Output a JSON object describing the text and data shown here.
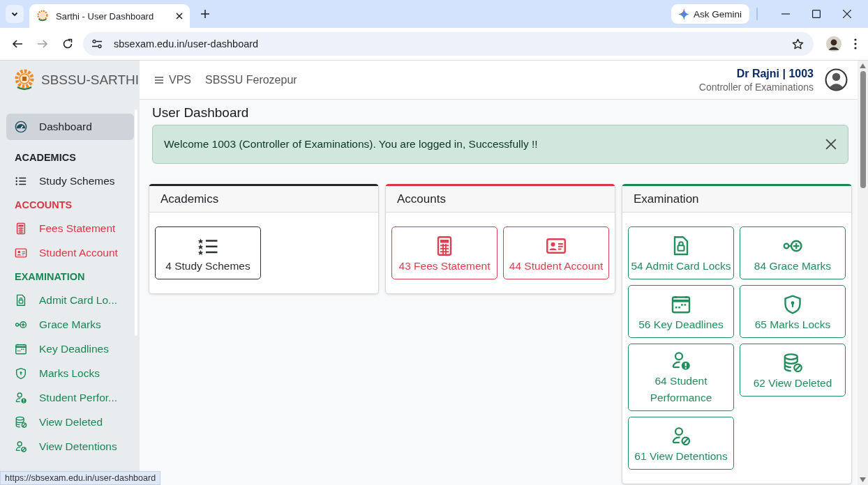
{
  "browser": {
    "tab_title": "Sarthi - User Dashboard",
    "ask_button": "Ask Gemini",
    "url": "sbsexam.edu.in/user-dashboard",
    "status_url": "https://sbsexam.edu.in/user-dashboard"
  },
  "sidebar": {
    "brand": "SBSSU-SARTHI",
    "items": [
      {
        "label": "Dashboard",
        "selected": true
      }
    ],
    "groups": [
      {
        "title": "ACADEMICS",
        "color": "#212529",
        "items": [
          {
            "label": "Study Schemes",
            "selected": false
          }
        ]
      },
      {
        "title": "ACCOUNTS",
        "color": "#dc3545",
        "items": [
          {
            "label": "Fees Statement",
            "selected": false
          },
          {
            "label": "Student Account",
            "selected": false
          }
        ]
      },
      {
        "title": "EXAMINATION",
        "color": "#198754",
        "items": [
          {
            "label": "Admit Card Lo...",
            "selected": false
          },
          {
            "label": "Grace Marks",
            "selected": false
          },
          {
            "label": "Key Deadlines",
            "selected": false
          },
          {
            "label": "Marks Locks",
            "selected": false
          },
          {
            "label": "Student Perfor...",
            "selected": false
          },
          {
            "label": "View Deleted",
            "selected": false
          },
          {
            "label": "View Detentions",
            "selected": false
          }
        ]
      }
    ]
  },
  "header": {
    "menu": "VPS",
    "org": "SBSSU Ferozepur",
    "user": "Dr Rajni | 1003",
    "role": "Controller of Examinations"
  },
  "page_title": "User Dashboard",
  "alert": {
    "message": "Welcome 1003 (Controller of Examinations). You are logged in, Successfully !!"
  },
  "panels": [
    {
      "title": "Academics",
      "color": "#212529",
      "tiles": [
        {
          "label": "4 Study Schemes"
        }
      ]
    },
    {
      "title": "Accounts",
      "color": "#dc3545",
      "tiles": [
        {
          "label": "43 Fees Statement"
        },
        {
          "label": "44 Student Account"
        }
      ]
    },
    {
      "title": "Examination",
      "color": "#198754",
      "tiles": [
        {
          "label": "54 Admit Card Locks"
        },
        {
          "label": "84 Grace Marks"
        },
        {
          "label": "56 Key Deadlines"
        },
        {
          "label": "65 Marks Locks"
        },
        {
          "label": "64 Student Performance"
        },
        {
          "label": "62 View Deleted"
        },
        {
          "label": "61 View Detentions"
        }
      ]
    }
  ]
}
